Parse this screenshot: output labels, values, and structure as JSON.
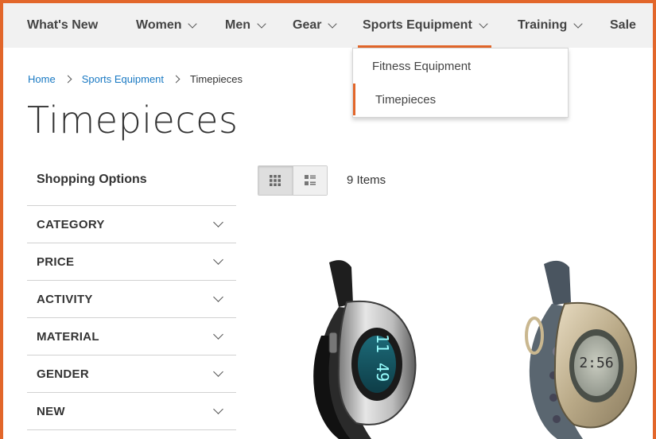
{
  "nav": {
    "items": [
      {
        "label": "What's New",
        "has_dropdown": false
      },
      {
        "label": "Women",
        "has_dropdown": true
      },
      {
        "label": "Men",
        "has_dropdown": true
      },
      {
        "label": "Gear",
        "has_dropdown": true
      },
      {
        "label": "Sports Equipment",
        "has_dropdown": true,
        "active": true
      },
      {
        "label": "Training",
        "has_dropdown": true
      },
      {
        "label": "Sale",
        "has_dropdown": false
      }
    ],
    "dropdown": [
      {
        "label": "Fitness Equipment"
      },
      {
        "label": "Timepieces",
        "active": true
      }
    ]
  },
  "breadcrumb": {
    "home": "Home",
    "parent": "Sports Equipment",
    "current": "Timepieces"
  },
  "page": {
    "title": "Timepieces"
  },
  "sidebar": {
    "title": "Shopping Options",
    "filters": [
      "CATEGORY",
      "PRICE",
      "ACTIVITY",
      "MATERIAL",
      "GENDER",
      "NEW"
    ]
  },
  "toolbar": {
    "grid_mode": "grid-icon",
    "list_mode": "list-icon",
    "item_count": "9 Items"
  },
  "products": {
    "watch1_display": "11 49",
    "watch2_display": "2:56"
  },
  "colors": {
    "accent": "#e2662a",
    "link": "#1979c3"
  }
}
